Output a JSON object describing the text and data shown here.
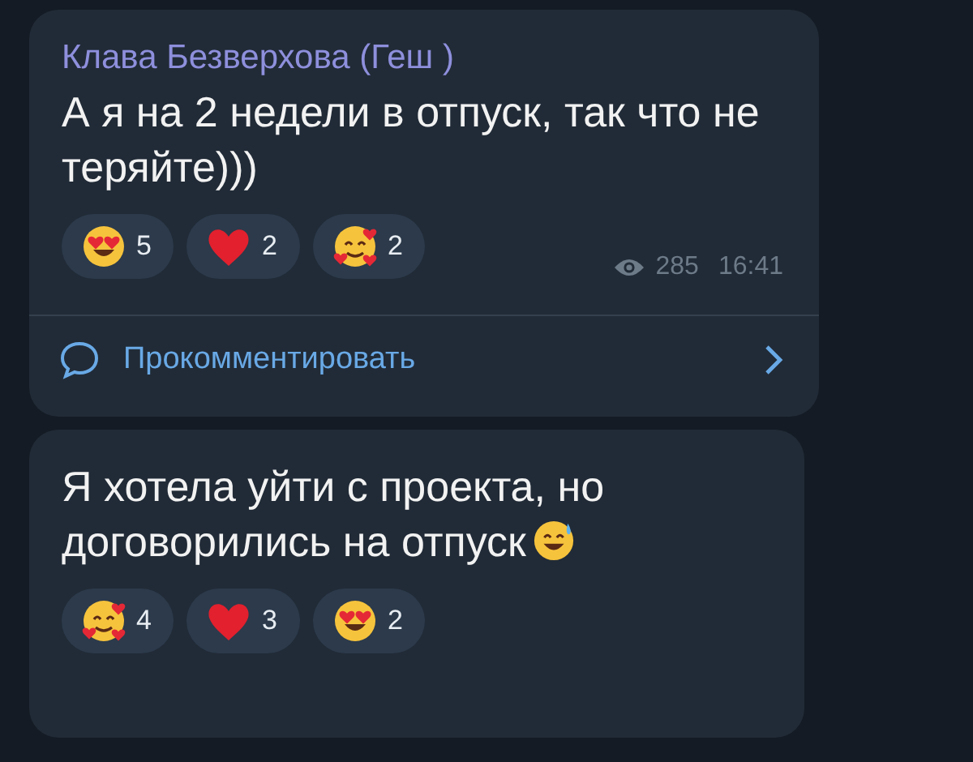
{
  "messages": [
    {
      "author": "Клава Безверхова (Геш )",
      "text": "А я на 2 недели в отпуск, так что не теряйте)))",
      "reactions": [
        {
          "kind": "heart_eyes",
          "count": "5"
        },
        {
          "kind": "heart",
          "count": "2"
        },
        {
          "kind": "hearts_face",
          "count": "2"
        }
      ],
      "views": "285",
      "time": "16:41",
      "comment_label": "Прокомментировать"
    },
    {
      "text": "Я хотела уйти с проекта, но договорились на отпуск",
      "trailing_icon": {
        "kind": "sweat_smile"
      },
      "reactions": [
        {
          "kind": "hearts_face",
          "count": "4"
        },
        {
          "kind": "heart",
          "count": "3"
        },
        {
          "kind": "heart_eyes",
          "count": "2"
        }
      ]
    }
  ]
}
